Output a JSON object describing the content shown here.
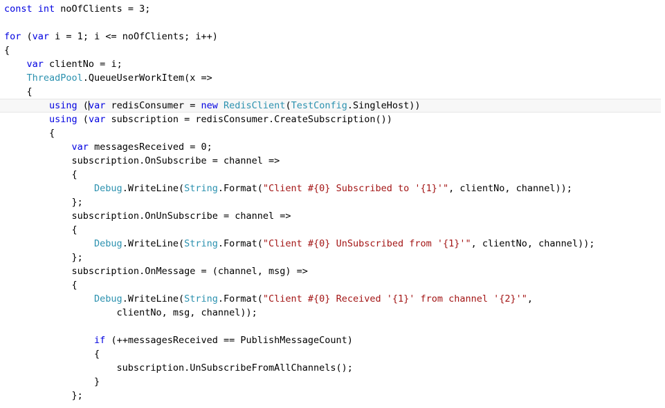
{
  "editor": {
    "app": "code-editor",
    "language": "csharp",
    "theme": "light",
    "colors": {
      "background": "#ffffff",
      "foreground": "#000000",
      "keyword": "#0000e0",
      "type": "#2b91af",
      "string": "#a31515",
      "current_line_bg": "#f7f7f7",
      "current_line_border": "#e6e6e6"
    },
    "caret": {
      "visible": true,
      "line_index": 7,
      "after_text": "            using ("
    },
    "lines": [
      {
        "index": 0,
        "current": false,
        "tokens": [
          {
            "t": "kw",
            "v": "const"
          },
          {
            "t": "pln",
            "v": " "
          },
          {
            "t": "kw",
            "v": "int"
          },
          {
            "t": "pln",
            "v": " noOfClients = 3;"
          }
        ]
      },
      {
        "index": 1,
        "current": false,
        "tokens": []
      },
      {
        "index": 2,
        "current": false,
        "tokens": [
          {
            "t": "kw",
            "v": "for"
          },
          {
            "t": "pln",
            "v": " ("
          },
          {
            "t": "kw",
            "v": "var"
          },
          {
            "t": "pln",
            "v": " i = 1; i <= noOfClients; i++)"
          }
        ]
      },
      {
        "index": 3,
        "current": false,
        "tokens": [
          {
            "t": "pln",
            "v": "{"
          }
        ]
      },
      {
        "index": 4,
        "current": false,
        "tokens": [
          {
            "t": "pln",
            "v": "    "
          },
          {
            "t": "kw",
            "v": "var"
          },
          {
            "t": "pln",
            "v": " clientNo = i;"
          }
        ]
      },
      {
        "index": 5,
        "current": false,
        "tokens": [
          {
            "t": "pln",
            "v": "    "
          },
          {
            "t": "typ",
            "v": "ThreadPool"
          },
          {
            "t": "pln",
            "v": ".QueueUserWorkItem(x =>"
          }
        ]
      },
      {
        "index": 6,
        "current": false,
        "tokens": [
          {
            "t": "pln",
            "v": "    {"
          }
        ]
      },
      {
        "index": 7,
        "current": true,
        "tokens": [
          {
            "t": "pln",
            "v": "        "
          },
          {
            "t": "kw",
            "v": "using"
          },
          {
            "t": "pln",
            "v": " ("
          },
          {
            "t": "caret",
            "v": ""
          },
          {
            "t": "kw",
            "v": "var"
          },
          {
            "t": "pln",
            "v": " redisConsumer = "
          },
          {
            "t": "kw",
            "v": "new"
          },
          {
            "t": "pln",
            "v": " "
          },
          {
            "t": "typ",
            "v": "RedisClient"
          },
          {
            "t": "pln",
            "v": "("
          },
          {
            "t": "typ",
            "v": "TestConfig"
          },
          {
            "t": "pln",
            "v": ".SingleHost))"
          }
        ]
      },
      {
        "index": 8,
        "current": false,
        "tokens": [
          {
            "t": "pln",
            "v": "        "
          },
          {
            "t": "kw",
            "v": "using"
          },
          {
            "t": "pln",
            "v": " ("
          },
          {
            "t": "kw",
            "v": "var"
          },
          {
            "t": "pln",
            "v": " subscription = redisConsumer.CreateSubscription())"
          }
        ]
      },
      {
        "index": 9,
        "current": false,
        "tokens": [
          {
            "t": "pln",
            "v": "        {"
          }
        ]
      },
      {
        "index": 10,
        "current": false,
        "tokens": [
          {
            "t": "pln",
            "v": "            "
          },
          {
            "t": "kw",
            "v": "var"
          },
          {
            "t": "pln",
            "v": " messagesReceived = 0;"
          }
        ]
      },
      {
        "index": 11,
        "current": false,
        "tokens": [
          {
            "t": "pln",
            "v": "            subscription.OnSubscribe = channel =>"
          }
        ]
      },
      {
        "index": 12,
        "current": false,
        "tokens": [
          {
            "t": "pln",
            "v": "            {"
          }
        ]
      },
      {
        "index": 13,
        "current": false,
        "tokens": [
          {
            "t": "pln",
            "v": "                "
          },
          {
            "t": "typ",
            "v": "Debug"
          },
          {
            "t": "pln",
            "v": ".WriteLine("
          },
          {
            "t": "typ",
            "v": "String"
          },
          {
            "t": "pln",
            "v": ".Format("
          },
          {
            "t": "str",
            "v": "\"Client #{0} Subscribed to '{1}'\""
          },
          {
            "t": "pln",
            "v": ", clientNo, channel));"
          }
        ]
      },
      {
        "index": 14,
        "current": false,
        "tokens": [
          {
            "t": "pln",
            "v": "            };"
          }
        ]
      },
      {
        "index": 15,
        "current": false,
        "tokens": [
          {
            "t": "pln",
            "v": "            subscription.OnUnSubscribe = channel =>"
          }
        ]
      },
      {
        "index": 16,
        "current": false,
        "tokens": [
          {
            "t": "pln",
            "v": "            {"
          }
        ]
      },
      {
        "index": 17,
        "current": false,
        "tokens": [
          {
            "t": "pln",
            "v": "                "
          },
          {
            "t": "typ",
            "v": "Debug"
          },
          {
            "t": "pln",
            "v": ".WriteLine("
          },
          {
            "t": "typ",
            "v": "String"
          },
          {
            "t": "pln",
            "v": ".Format("
          },
          {
            "t": "str",
            "v": "\"Client #{0} UnSubscribed from '{1}'\""
          },
          {
            "t": "pln",
            "v": ", clientNo, channel));"
          }
        ]
      },
      {
        "index": 18,
        "current": false,
        "tokens": [
          {
            "t": "pln",
            "v": "            };"
          }
        ]
      },
      {
        "index": 19,
        "current": false,
        "tokens": [
          {
            "t": "pln",
            "v": "            subscription.OnMessage = (channel, msg) =>"
          }
        ]
      },
      {
        "index": 20,
        "current": false,
        "tokens": [
          {
            "t": "pln",
            "v": "            {"
          }
        ]
      },
      {
        "index": 21,
        "current": false,
        "tokens": [
          {
            "t": "pln",
            "v": "                "
          },
          {
            "t": "typ",
            "v": "Debug"
          },
          {
            "t": "pln",
            "v": ".WriteLine("
          },
          {
            "t": "typ",
            "v": "String"
          },
          {
            "t": "pln",
            "v": ".Format("
          },
          {
            "t": "str",
            "v": "\"Client #{0} Received '{1}' from channel '{2}'\""
          },
          {
            "t": "pln",
            "v": ","
          }
        ]
      },
      {
        "index": 22,
        "current": false,
        "tokens": [
          {
            "t": "pln",
            "v": "                    clientNo, msg, channel));"
          }
        ]
      },
      {
        "index": 23,
        "current": false,
        "tokens": []
      },
      {
        "index": 24,
        "current": false,
        "tokens": [
          {
            "t": "pln",
            "v": "                "
          },
          {
            "t": "kw",
            "v": "if"
          },
          {
            "t": "pln",
            "v": " (++messagesReceived == PublishMessageCount)"
          }
        ]
      },
      {
        "index": 25,
        "current": false,
        "tokens": [
          {
            "t": "pln",
            "v": "                {"
          }
        ]
      },
      {
        "index": 26,
        "current": false,
        "tokens": [
          {
            "t": "pln",
            "v": "                    subscription.UnSubscribeFromAllChannels();"
          }
        ]
      },
      {
        "index": 27,
        "current": false,
        "tokens": [
          {
            "t": "pln",
            "v": "                }"
          }
        ]
      },
      {
        "index": 28,
        "current": false,
        "tokens": [
          {
            "t": "pln",
            "v": "            };"
          }
        ]
      }
    ]
  }
}
